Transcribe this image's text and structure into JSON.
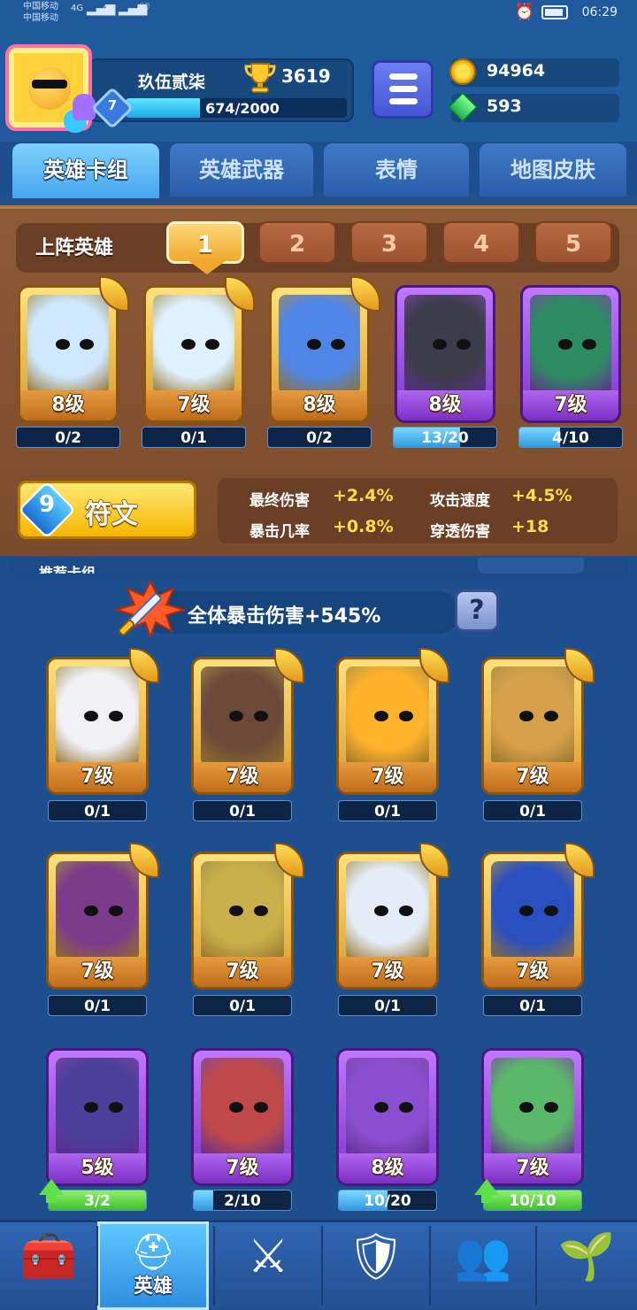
{
  "status_bar": {
    "carrier_1": "中国移动",
    "carrier_2": "中国移动",
    "signal_1": "4G",
    "signal_2": "4G",
    "time": "06:29"
  },
  "player": {
    "name": "玖伍贰柒",
    "trophies": "3619",
    "level": "7",
    "xp_text": "674/2000",
    "xp_fraction": 0.337
  },
  "currency": {
    "coins": "94964",
    "gems": "593"
  },
  "tabs": [
    {
      "label": "英雄卡组",
      "active": true
    },
    {
      "label": "英雄武器",
      "active": false
    },
    {
      "label": "表情",
      "active": false
    },
    {
      "label": "地图皮肤",
      "active": false
    }
  ],
  "deck": {
    "header_label": "上阵英雄",
    "slots": [
      "1",
      "2",
      "3",
      "4",
      "5"
    ],
    "active_slot": "1",
    "cards": [
      {
        "name": "yeti-hero",
        "rarity": "gold",
        "level": "8级",
        "progress": "0/2",
        "fraction": 0
      },
      {
        "name": "zeus-hero",
        "rarity": "gold",
        "level": "7级",
        "progress": "0/1",
        "fraction": 0
      },
      {
        "name": "frost-king-hero",
        "rarity": "gold",
        "level": "8级",
        "progress": "0/2",
        "fraction": 0
      },
      {
        "name": "bandit-hero",
        "rarity": "epic",
        "level": "8级",
        "progress": "13/20",
        "fraction": 0.65
      },
      {
        "name": "reaper-hero",
        "rarity": "epic",
        "level": "7级",
        "progress": "4/10",
        "fraction": 0.4
      }
    ]
  },
  "runes": {
    "button_label": "符文",
    "rune_glyph": "9",
    "stats": [
      {
        "name": "最终伤害",
        "value": "+2.4%"
      },
      {
        "name": "攻击速度",
        "value": "+4.5%"
      },
      {
        "name": "暴击几率",
        "value": "+0.8%"
      },
      {
        "name": "穿透伤害",
        "value": "+18"
      }
    ]
  },
  "collection": {
    "section_title": "推荐卡组",
    "bonus_text": "全体暴击伤害+545%",
    "help_label": "?",
    "cards": [
      {
        "name": "hooded-mage-hero",
        "rarity": "gold",
        "level": "7级",
        "progress": "0/1",
        "fraction": 0,
        "upgrade": false
      },
      {
        "name": "lava-golem-hero",
        "rarity": "gold",
        "level": "7级",
        "progress": "0/1",
        "fraction": 0,
        "upgrade": false
      },
      {
        "name": "flame-spirit-hero",
        "rarity": "gold",
        "level": "7级",
        "progress": "0/1",
        "fraction": 0,
        "upgrade": false
      },
      {
        "name": "cowboy-hero",
        "rarity": "gold",
        "level": "7级",
        "progress": "0/1",
        "fraction": 0,
        "upgrade": false
      },
      {
        "name": "skull-witch-hero",
        "rarity": "gold",
        "level": "7级",
        "progress": "0/1",
        "fraction": 0,
        "upgrade": false
      },
      {
        "name": "knight-hero",
        "rarity": "gold",
        "level": "7级",
        "progress": "0/1",
        "fraction": 0,
        "upgrade": false
      },
      {
        "name": "mecha-hero",
        "rarity": "gold",
        "level": "7级",
        "progress": "0/1",
        "fraction": 0,
        "upgrade": false
      },
      {
        "name": "blue-hair-girl-hero",
        "rarity": "gold",
        "level": "7级",
        "progress": "0/1",
        "fraction": 0,
        "upgrade": false
      },
      {
        "name": "sheriff-hero",
        "rarity": "epic",
        "level": "5级",
        "progress": "3/2",
        "fraction": 1,
        "upgrade": true
      },
      {
        "name": "bomb-hero",
        "rarity": "epic",
        "level": "7级",
        "progress": "2/10",
        "fraction": 0.2,
        "upgrade": false
      },
      {
        "name": "magician-hero",
        "rarity": "epic",
        "level": "8级",
        "progress": "10/20",
        "fraction": 0.5,
        "upgrade": false
      },
      {
        "name": "robot-hero",
        "rarity": "epic",
        "level": "7级",
        "progress": "10/10",
        "fraction": 1,
        "upgrade": true
      }
    ]
  },
  "bottom_nav": [
    {
      "name": "shop",
      "icon": "treasure-chest-icon",
      "label": "",
      "active": false
    },
    {
      "name": "heroes",
      "icon": "knight-helmet-icon",
      "label": "英雄",
      "active": true
    },
    {
      "name": "battle",
      "icon": "crossed-swords-icon",
      "label": "",
      "active": false
    },
    {
      "name": "clan",
      "icon": "shield-crown-icon",
      "label": "",
      "active": false
    },
    {
      "name": "social",
      "icon": "friends-banner-icon",
      "label": "",
      "active": false
    },
    {
      "name": "map",
      "icon": "sprout-island-icon",
      "label": "",
      "active": false
    }
  ],
  "colors": {
    "gold_frame": "#f0b53a",
    "epic_frame": "#9b4fe0",
    "progress_blue": "#2e9be0",
    "progress_green": "#3fbf2a",
    "stat_value_yellow": "#ffdc4a"
  }
}
